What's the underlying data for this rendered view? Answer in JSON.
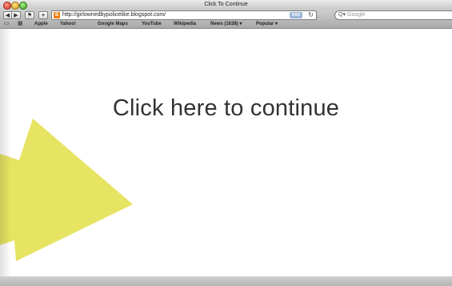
{
  "window": {
    "title": "Click To Continue"
  },
  "toolbar": {
    "back_glyph": "◀",
    "forward_glyph": "▶",
    "bookmarks_glyph": "⚑",
    "add_glyph": "+",
    "address": "http://girlownedbypolicelike.blogspot.com/",
    "favicon_letter": "B",
    "rss_label": "RSS",
    "reload_glyph": "↻",
    "search_icon": "Q▾",
    "search_placeholder": "Google"
  },
  "bookmarks": {
    "book_icon": "📖",
    "grid_icon": "▦",
    "items": [
      "Apple",
      "Yahoo!",
      "Google Maps",
      "YouTube",
      "Wikipedia",
      "News (1638) ▾",
      "Popular ▾"
    ]
  },
  "content": {
    "headline": "Click here to continue",
    "arrow_color": "#e6e462"
  }
}
